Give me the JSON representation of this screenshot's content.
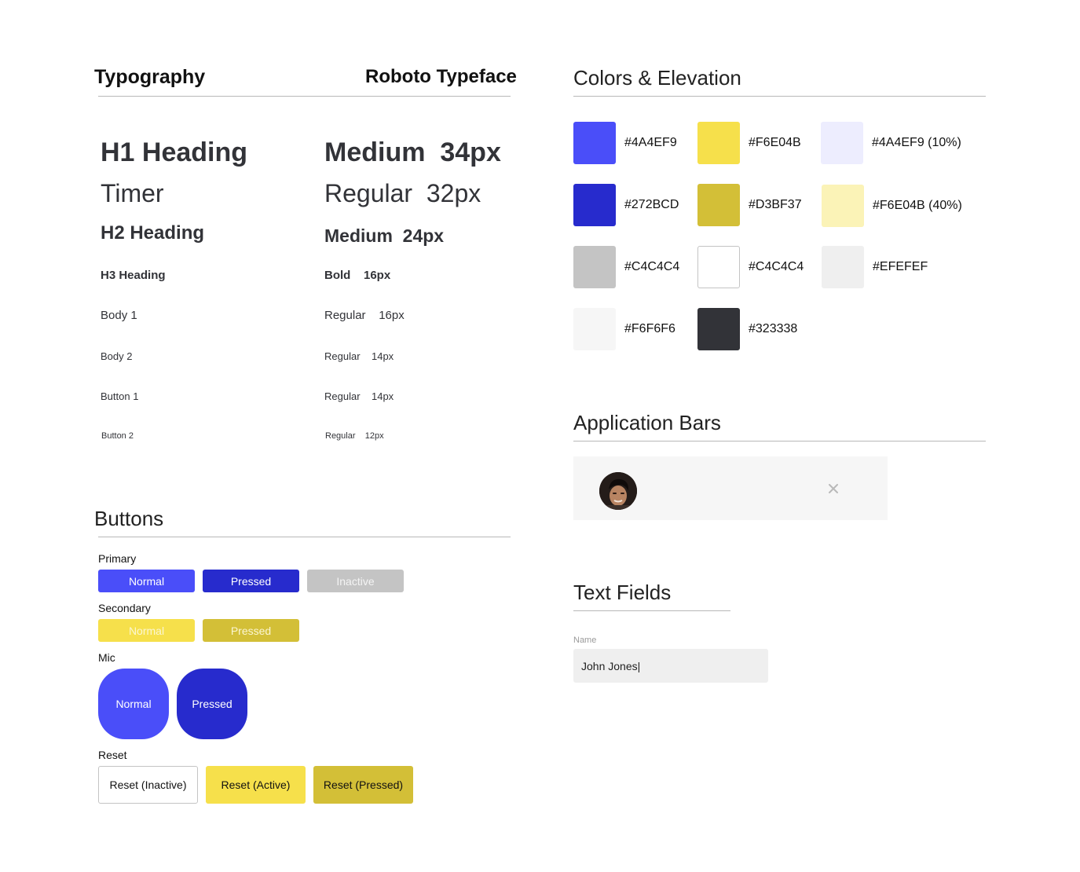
{
  "typography": {
    "title": "Typography",
    "typeface": "Roboto Typeface",
    "rows": [
      {
        "name": "H1 Heading",
        "spec_weight": "Medium",
        "spec_size": "34px"
      },
      {
        "name": "Timer",
        "spec_weight": "Regular",
        "spec_size": "32px"
      },
      {
        "name": "H2 Heading",
        "spec_weight": "Medium",
        "spec_size": "24px"
      },
      {
        "name": "H3 Heading",
        "spec_weight": "Bold",
        "spec_size": "16px"
      },
      {
        "name": "Body 1",
        "spec_weight": "Regular",
        "spec_size": "16px"
      },
      {
        "name": "Body 2",
        "spec_weight": "Regular",
        "spec_size": "14px"
      },
      {
        "name": "Button 1",
        "spec_weight": "Regular",
        "spec_size": "14px"
      },
      {
        "name": "Button 2",
        "spec_weight": "Regular",
        "spec_size": "12px"
      }
    ]
  },
  "colors": {
    "title": "Colors & Elevation",
    "swatches": [
      {
        "label": "#4A4EF9",
        "color": "#4A4EF9"
      },
      {
        "label": "#F6E04B",
        "color": "#F6E04B"
      },
      {
        "label": "#4A4EF9 (10%)",
        "color": "#EDEDFE"
      },
      {
        "label": "#272BCD",
        "color": "#272BCD"
      },
      {
        "label": "#D3BF37",
        "color": "#D3BF37"
      },
      {
        "label": "#F6E04B (40%)",
        "color": "#FBF3B7"
      },
      {
        "label": "#C4C4C4",
        "color": "#C4C4C4"
      },
      {
        "label": "#C4C4C4",
        "color": "#FFFFFF"
      },
      {
        "label": "#EFEFEF",
        "color": "#EFEFEF"
      },
      {
        "label": "#F6F6F6",
        "color": "#F6F6F6"
      },
      {
        "label": "#323338",
        "color": "#323338"
      }
    ]
  },
  "app_bars": {
    "title": "Application Bars",
    "close_icon": "close-icon"
  },
  "text_fields": {
    "title": "Text Fields",
    "label": "Name",
    "value": "John Jones|"
  },
  "buttons": {
    "title": "Buttons",
    "primary": {
      "label": "Primary",
      "normal": "Normal",
      "pressed": "Pressed",
      "inactive": "Inactive"
    },
    "secondary": {
      "label": "Secondary",
      "normal": "Normal",
      "pressed": "Pressed"
    },
    "mic": {
      "label": "Mic",
      "normal": "Normal",
      "pressed": "Pressed"
    },
    "reset": {
      "label": "Reset",
      "inactive": "Reset (Inactive)",
      "active": "Reset (Active)",
      "pressed": "Reset (Pressed)"
    }
  }
}
